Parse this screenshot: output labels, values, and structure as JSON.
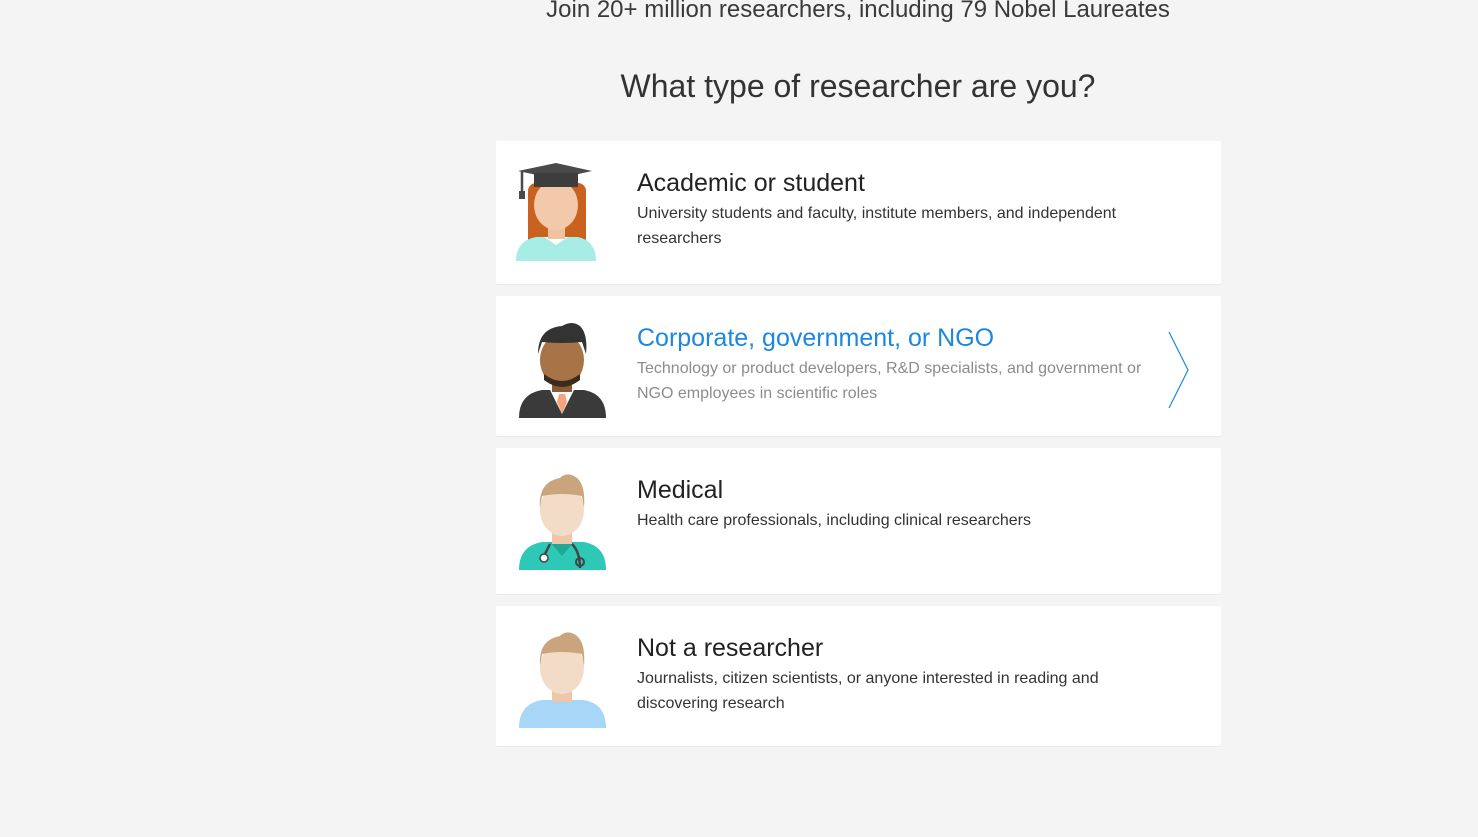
{
  "header": {
    "tagline": "Join 20+ million researchers, including 79 Nobel Laureates",
    "question": "What type of researcher are you?"
  },
  "options": [
    {
      "title": "Academic or student",
      "description": "University students and faculty, institute members, and independent researchers",
      "icon": "graduate-avatar-icon"
    },
    {
      "title": "Corporate, government, or NGO",
      "description": "Technology or product developers, R&D specialists, and government or NGO employees in scientific roles",
      "icon": "businessman-avatar-icon",
      "hovered": true
    },
    {
      "title": "Medical",
      "description": "Health care professionals, including clinical researchers",
      "icon": "doctor-avatar-icon"
    },
    {
      "title": "Not a researcher",
      "description": "Journalists, citizen scientists, or anyone interested in reading and discovering research",
      "icon": "person-avatar-icon"
    }
  ],
  "colors": {
    "background": "#f4f4f4",
    "card": "#ffffff",
    "accent": "#1b87e0"
  }
}
